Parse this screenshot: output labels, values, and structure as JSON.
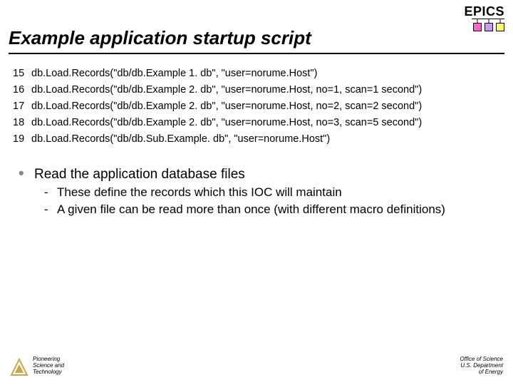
{
  "logo": {
    "text": "EPICS"
  },
  "title": "Example application startup script",
  "code": [
    {
      "n": "15",
      "t": "db.Load.Records(\"db/db.Example 1. db\", \"user=norume.Host\")"
    },
    {
      "n": "16",
      "t": "db.Load.Records(\"db/db.Example 2. db\", \"user=norume.Host, no=1, scan=1 second\")"
    },
    {
      "n": "17",
      "t": "db.Load.Records(\"db/db.Example 2. db\", \"user=norume.Host, no=2, scan=2 second\")"
    },
    {
      "n": "18",
      "t": "db.Load.Records(\"db/db.Example 2. db\", \"user=norume.Host, no=3, scan=5 second\")"
    },
    {
      "n": "19",
      "t": "db.Load.Records(\"db/db.Sub.Example. db\", \"user=norume.Host\")"
    }
  ],
  "bullet": {
    "main": "Read the application database files",
    "subs": [
      "These define the records which this IOC will maintain",
      "A given file can be read more than once (with different macro definitions)"
    ]
  },
  "footer": {
    "left1": "Pioneering",
    "left2": "Science and",
    "left3": "Technology",
    "right1": "Office of Science",
    "right2": "U.S. Department",
    "right3": "of Energy"
  }
}
